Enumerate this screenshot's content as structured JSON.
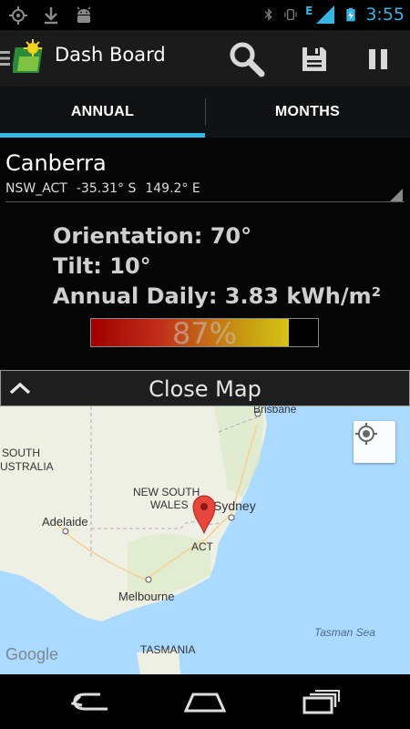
{
  "status_bar": {
    "time": "3:55",
    "left_icons": [
      "gps-icon",
      "download-icon",
      "android-icon"
    ],
    "right_icons": [
      "bluetooth-icon",
      "vibrate-icon",
      "edge-signal-icon",
      "signal-icon",
      "battery-charging-icon"
    ],
    "network_label": "E",
    "accent": "#33b5e5"
  },
  "action_bar": {
    "title": "Dash Board",
    "buttons": [
      "search-icon",
      "save-icon",
      "pause-icon"
    ]
  },
  "tabs": [
    {
      "label": "ANNUAL",
      "active": true
    },
    {
      "label": "MONTHS",
      "active": false
    }
  ],
  "location": {
    "city": "Canberra",
    "region": "NSW_ACT",
    "latitude": "-35.31° S",
    "longitude": "149.2° E"
  },
  "stats": {
    "orientation": "Orientation: 70°",
    "tilt": "Tilt: 10°",
    "annual_daily": "Annual Daily: 3.83 kWh/m²"
  },
  "efficiency": {
    "percent": 87,
    "label": "87%"
  },
  "map_toggle": {
    "label": "Close Map"
  },
  "map": {
    "labels": {
      "brisbane": "Brisbane",
      "south": "SOUTH",
      "australia": "AUSTRALIA",
      "nsw1": "NEW SOUTH",
      "nsw2": "WALES",
      "sydney": "Sydney",
      "adelaide": "Adelaide",
      "act": "ACT",
      "melbourne": "Melbourne",
      "tasman_sea": "Tasman Sea",
      "tasmania": "TASMANIA"
    },
    "attribution": "Google",
    "marker_color": "#e8453c"
  },
  "nav_bar": {
    "buttons": [
      "back-icon",
      "home-icon",
      "recent-apps-icon"
    ]
  }
}
